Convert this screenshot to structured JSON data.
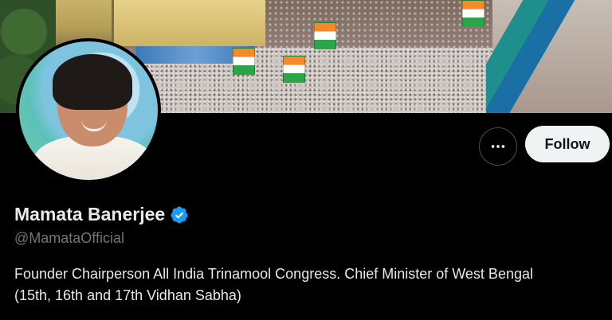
{
  "profile": {
    "display_name": "Mamata Banerjee",
    "handle": "@MamataOfficial",
    "bio_line_1": "Founder Chairperson All India Trinamool Congress. Chief Minister of West Bengal",
    "bio_line_2": "(15th, 16th and 17th Vidhan Sabha)",
    "verified": true
  },
  "actions": {
    "follow_label": "Follow",
    "more_icon": "more-horizontal-icon"
  },
  "icons": {
    "verified_icon": "verified-badge-icon"
  },
  "colors": {
    "background": "#000000",
    "text_primary": "#e7e9ea",
    "text_secondary": "#71767b",
    "follow_bg": "#eff3f4",
    "verified_blue": "#1d9bf0"
  }
}
